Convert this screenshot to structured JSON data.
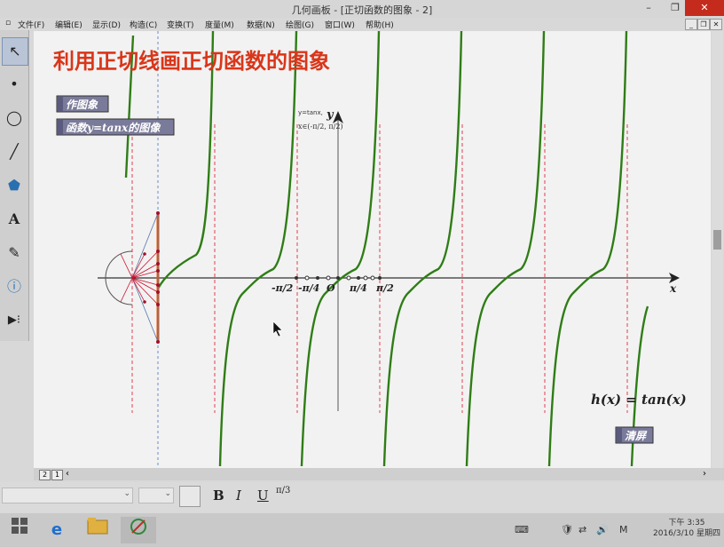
{
  "window": {
    "title": "几何画板 - [正切函数的图象 - 2]",
    "min": "–",
    "max": "❐",
    "close": "✕"
  },
  "menu": [
    "文件(F)",
    "编辑(E)",
    "显示(D)",
    "构造(C)",
    "变换(T)",
    "度量(M)",
    "数据(N)",
    "绘图(G)",
    "窗口(W)",
    "帮助(H)"
  ],
  "doc_controls": [
    "_",
    "❐",
    "✕"
  ],
  "tools": [
    {
      "name": "arrow-tool",
      "glyph": "↖"
    },
    {
      "name": "point-tool",
      "glyph": "•"
    },
    {
      "name": "compass-tool",
      "glyph": "◯"
    },
    {
      "name": "straightedge-tool",
      "glyph": "╱"
    },
    {
      "name": "polygon-tool",
      "glyph": "⬟"
    },
    {
      "name": "text-tool",
      "glyph": "A"
    },
    {
      "name": "marker-tool",
      "glyph": "✎"
    },
    {
      "name": "information-tool",
      "glyph": "ⓘ"
    },
    {
      "name": "custom-tool",
      "glyph": "▶⁝"
    }
  ],
  "canvas": {
    "heading": "利用正切线画正切函数的图象",
    "btn_draw": "作图象",
    "btn_graph": "函数y=tanx的图像",
    "label_func": "y=tanx,",
    "label_domain": "x∈(-π/2, π/2)",
    "axis_x": "x",
    "axis_y": "y",
    "tick_neg_pi2": "-π/2",
    "tick_neg_pi4": "-π/4",
    "tick_origin": "O",
    "tick_pi4": "π/4",
    "tick_pi2": "π/2",
    "formula": "h(x) = tan(x)",
    "btn_clear": "清屏",
    "colors": {
      "curve": "#2f7d16",
      "asymptote": "#e04050",
      "heading": "#d9361a",
      "button_bg": "#7a7a9a",
      "construction": "#c8102e"
    }
  },
  "pages": [
    "2",
    "1"
  ],
  "format": {
    "bold": "B",
    "italic": "I",
    "underline": "U",
    "math": "π/3"
  },
  "taskbar": {
    "apps": [
      "ie-icon",
      "explorer-icon",
      "sketchpad-icon"
    ],
    "tray": [
      "⌨",
      "🛡",
      "⇄",
      "🔊",
      "M"
    ],
    "time": "下午 3:35",
    "date": "2016/3/10 星期四"
  }
}
